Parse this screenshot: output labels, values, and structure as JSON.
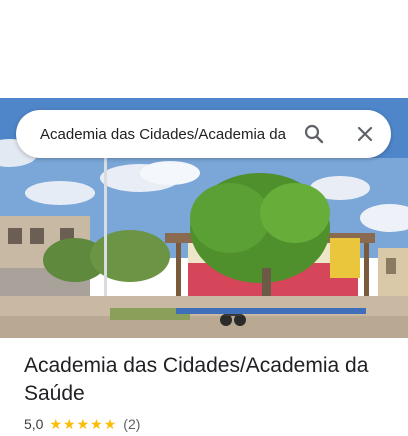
{
  "search": {
    "query": "Academia das Cidades/Academia da"
  },
  "place": {
    "title": "Academia das Cidades/Academia da Saúde",
    "rating": "5,0",
    "stars_filled": 5,
    "review_count": "(2)"
  },
  "icons": {
    "search": "search-icon",
    "close": "close-icon",
    "star": "star-icon"
  },
  "colors": {
    "star": "#fbbc04",
    "title": "#202124",
    "meta": "#5f6368"
  }
}
